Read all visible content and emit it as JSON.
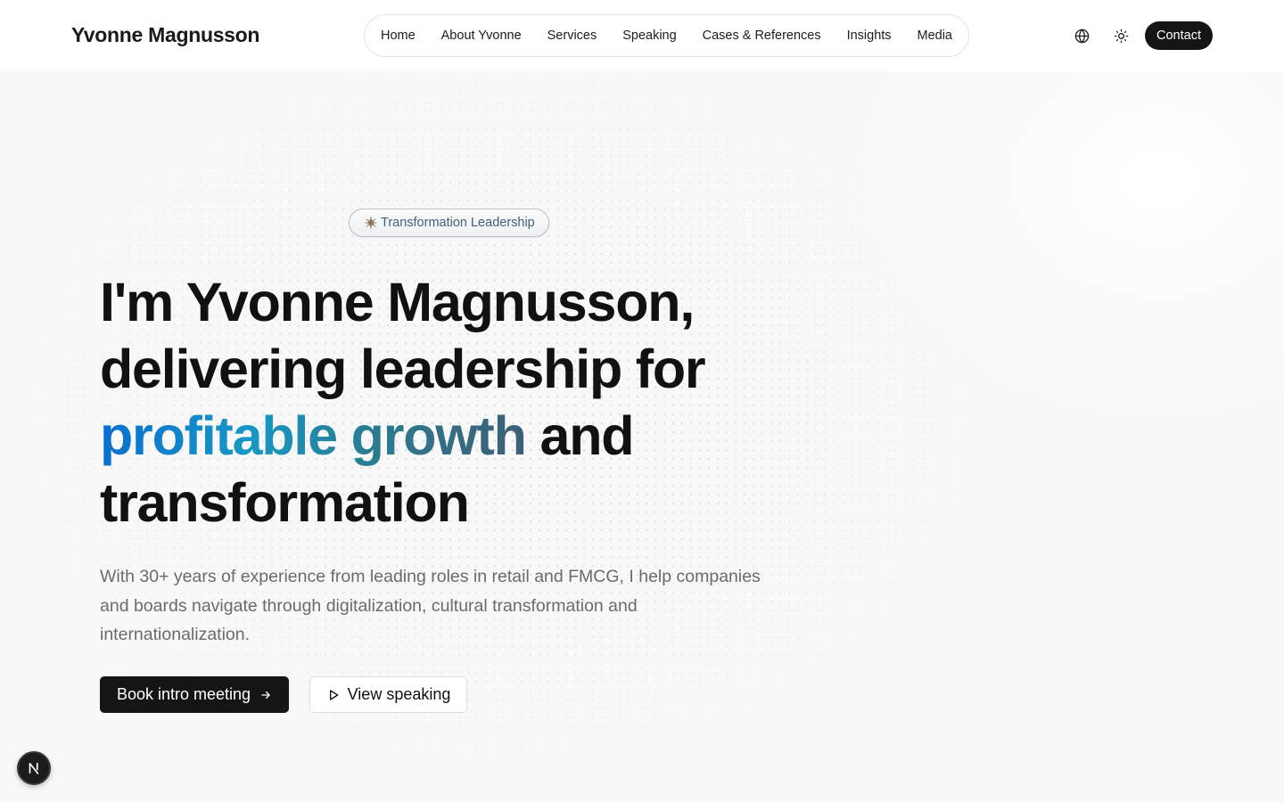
{
  "header": {
    "brand": "Yvonne Magnusson",
    "nav": [
      {
        "label": "Home"
      },
      {
        "label": "About Yvonne"
      },
      {
        "label": "Services"
      },
      {
        "label": "Speaking"
      },
      {
        "label": "Cases & References"
      },
      {
        "label": "Insights"
      },
      {
        "label": "Media"
      }
    ],
    "language_icon": "globe-icon",
    "theme_icon": "sun-icon",
    "contact_label": "Contact"
  },
  "hero": {
    "badge_icon": "sparkle-icon",
    "badge_label": "Transformation Leadership",
    "headline": {
      "line1": "I'm Yvonne Magnusson,",
      "line2": "delivering leadership for",
      "highlight": "profitable growth",
      "line3_rest": " and",
      "line4": "transformation"
    },
    "lead": "With 30+ years of experience from leading roles in retail and FMCG, I help companies and boards navigate through digitalization, cultural transformation and internationalization.",
    "primary_cta": "Book intro meeting",
    "primary_cta_icon": "arrow-right-icon",
    "secondary_cta": "View speaking",
    "secondary_cta_icon": "play-icon"
  },
  "dev_badge": {
    "icon": "nextjs-logo-icon",
    "letter": "N"
  },
  "colors": {
    "accent_start": "#0a6fd0",
    "accent_end": "#3e5f75",
    "button_dark": "#171513",
    "badge_text": "#46607a"
  }
}
